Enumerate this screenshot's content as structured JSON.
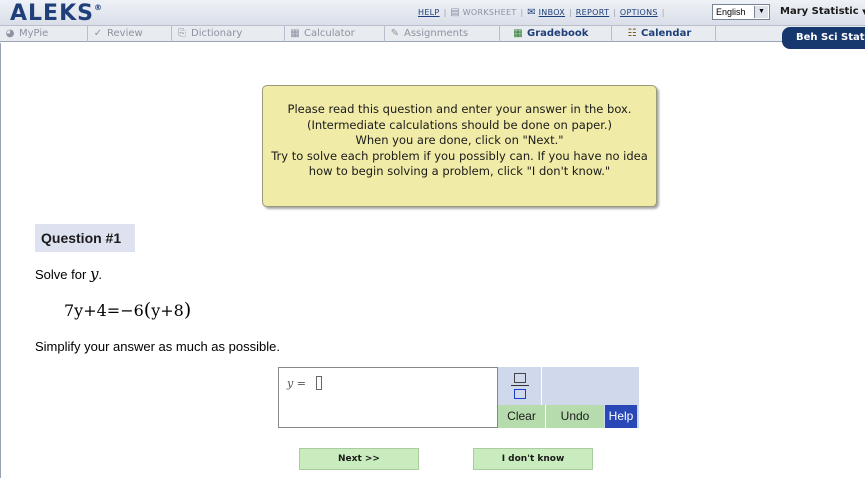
{
  "header": {
    "logo": "ALEKS",
    "links": [
      {
        "label": "HELP",
        "dim": false
      },
      {
        "label": "WORKSHEET",
        "dim": true,
        "icon": "document-icon"
      },
      {
        "label": "INBOX",
        "dim": false,
        "icon": "envelope-icon"
      },
      {
        "label": "REPORT",
        "dim": false
      },
      {
        "label": "OPTIONS",
        "dim": false
      }
    ],
    "language": "English",
    "user": "Mary Statistic"
  },
  "tabs": [
    {
      "label": "MyPie",
      "icon": "pie-icon",
      "active": false
    },
    {
      "label": "Review",
      "icon": "checkmark-icon",
      "active": false
    },
    {
      "label": "Dictionary",
      "icon": "book-icon",
      "active": false
    },
    {
      "label": "Calculator",
      "icon": "calculator-icon",
      "active": false
    },
    {
      "label": "Assignments",
      "icon": "pencil-icon",
      "active": false
    },
    {
      "label": "Gradebook",
      "icon": "gradebook-icon",
      "active": true
    },
    {
      "label": "Calendar",
      "icon": "calendar-icon",
      "active": true
    }
  ],
  "course_tab": "Beh Sci Stat",
  "instructions": [
    "Please read this question and enter your answer in the box.",
    "(Intermediate calculations should be done on paper.)",
    "When you are done, click on \"Next.\"",
    "Try to solve each problem if you possibly can. If you have no idea",
    "how to begin solving a problem, click \"I don't know.\""
  ],
  "question": {
    "number_label": "Question #1",
    "prompt_prefix": "Solve for",
    "variable": "y",
    "prompt_suffix": ".",
    "equation_lhs": "7y+4=−6",
    "equation_inner": "y+8",
    "simplify_note": "Simplify your answer as much as possible."
  },
  "answer": {
    "label": "y =",
    "value": ""
  },
  "tools": {
    "clear": "Clear",
    "undo": "Undo",
    "help": "Help"
  },
  "buttons": {
    "next": "Next >>",
    "dont_know": "I don't know"
  },
  "colors": {
    "brand": "#1f3f7a",
    "instruction_bg": "#f1eba8",
    "tool_green": "#b6dcae",
    "help_blue": "#2a47b8"
  }
}
